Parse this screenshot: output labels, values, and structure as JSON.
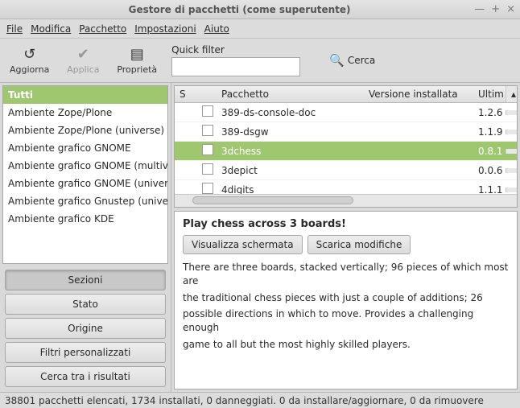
{
  "title": "Gestore di pacchetti  (come superutente)",
  "menu": [
    "File",
    "Modifica",
    "Pacchetto",
    "Impostazioni",
    "Aiuto"
  ],
  "toolbar": {
    "refresh": "Aggiorna",
    "apply": "Applica",
    "properties": "Proprietà",
    "quickfilter_label": "Quick filter",
    "quickfilter_value": "",
    "search": "Cerca"
  },
  "sections": [
    "Tutti",
    "Ambiente Zope/Plone",
    "Ambiente Zope/Plone (universe)",
    "Ambiente grafico GNOME",
    "Ambiente grafico GNOME (multiverse)",
    "Ambiente grafico GNOME (universe)",
    "Ambiente grafico Gnustep (universe)",
    "Ambiente grafico KDE"
  ],
  "selected_section_index": 0,
  "nav_buttons": {
    "sezioni": "Sezioni",
    "stato": "Stato",
    "origine": "Origine",
    "filtri": "Filtri personalizzati",
    "cerca": "Cerca tra i risultati"
  },
  "package_headers": {
    "s": "S",
    "name": "Pacchetto",
    "version": "Versione installata",
    "ult": "Ultim"
  },
  "packages": [
    {
      "name": "389-ds-console-doc",
      "ult": "1.2.6"
    },
    {
      "name": "389-dsgw",
      "ult": "1.1.9"
    },
    {
      "name": "3dchess",
      "ult": "0.8.1"
    },
    {
      "name": "3depict",
      "ult": "0.0.6"
    },
    {
      "name": "4digits",
      "ult": "1.1.1"
    }
  ],
  "selected_package_index": 2,
  "detail": {
    "title": "Play chess across 3 boards!",
    "btn_screenshot": "Visualizza schermata",
    "btn_changelog": "Scarica modifiche",
    "p1": "There are three boards, stacked vertically; 96 pieces of which most are",
    "p2": "the traditional chess pieces with just a couple of additions; 26",
    "p3": "possible directions in which to move. Provides a challenging enough",
    "p4": "game to all but the most highly skilled players."
  },
  "statusbar": "38801 pacchetti elencati, 1734 installati, 0 danneggiati. 0 da installare/aggiornare, 0 da rimuovere"
}
